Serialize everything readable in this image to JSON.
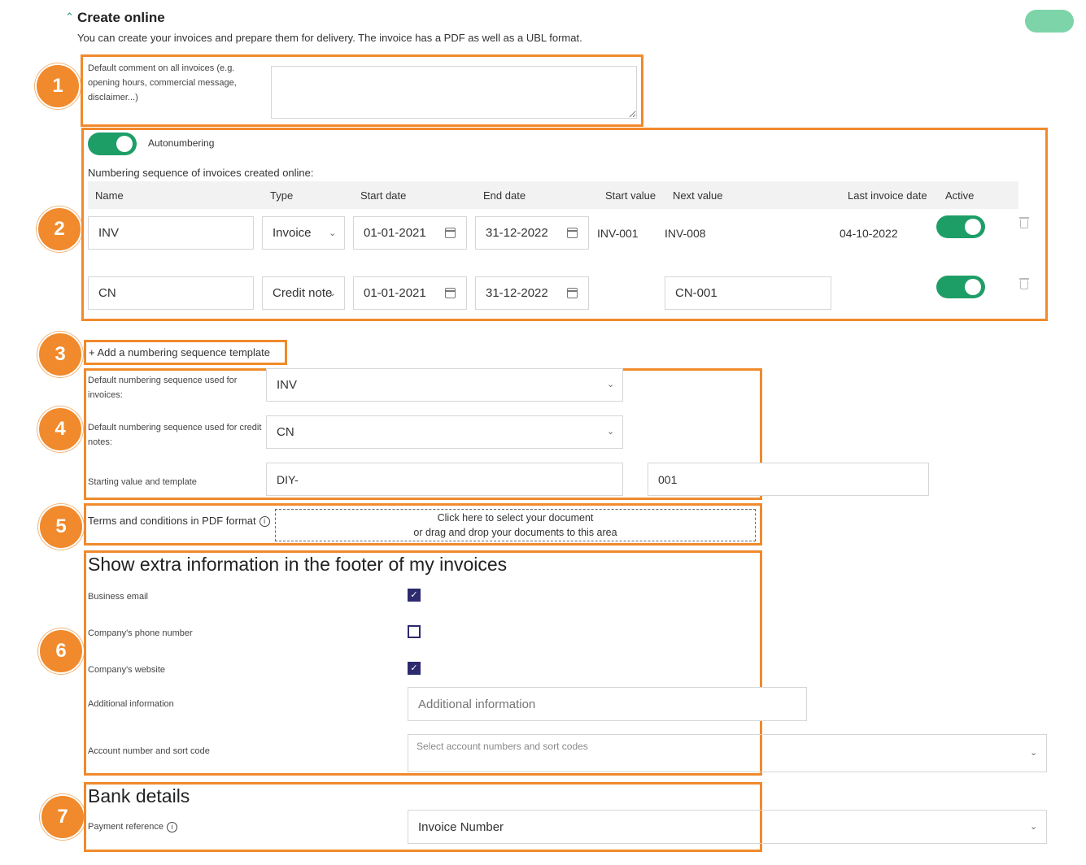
{
  "header": {
    "title": "Create online",
    "subtitle": "You can create your invoices and prepare them for delivery. The invoice has a PDF as well as a UBL format."
  },
  "badges": [
    "1",
    "2",
    "3",
    "4",
    "5",
    "6",
    "7"
  ],
  "section1": {
    "comment_label": "Default comment on all invoices (e.g. opening hours, commercial message, disclaimer...)",
    "comment_value": ""
  },
  "section2": {
    "autonumbering_label": "Autonumbering",
    "sequence_label": "Numbering sequence of invoices created online:",
    "columns": [
      "Name",
      "Type",
      "Start date",
      "End date",
      "Start value",
      "Next value",
      "Last invoice date",
      "Active"
    ],
    "rows": [
      {
        "name": "INV",
        "type": "Invoice",
        "start_date": "01-01-2021",
        "end_date": "31-12-2022",
        "start_value": "INV-001",
        "next_value": "INV-008",
        "last_invoice_date": "04-10-2022",
        "active": true
      },
      {
        "name": "CN",
        "type": "Credit note",
        "start_date": "01-01-2021",
        "end_date": "31-12-2022",
        "start_value": "",
        "next_value": "CN-001",
        "last_invoice_date": "",
        "active": true
      }
    ]
  },
  "section3": {
    "add_template_label": "+ Add a numbering sequence template"
  },
  "section4": {
    "invoices_label": "Default numbering sequence used for invoices:",
    "invoices_value": "INV",
    "credit_label": "Default numbering sequence used for credit notes:",
    "credit_value": "CN",
    "starting_label": "Starting value and template",
    "template_value": "DIY-",
    "start_value": "001"
  },
  "section5": {
    "terms_label": "Terms and conditions in PDF format",
    "drop_line1": "Click here to select your document",
    "drop_line2": "or drag and drop your documents to this area"
  },
  "section6": {
    "heading": "Show extra information in the footer of my invoices",
    "business_email_label": "Business email",
    "business_email_checked": true,
    "phone_label": "Company's phone number",
    "phone_checked": false,
    "website_label": "Company's website",
    "website_checked": true,
    "additional_label": "Additional information",
    "additional_placeholder": "Additional information",
    "account_label": "Account number and sort code",
    "account_placeholder": "Select account numbers and sort codes"
  },
  "section7": {
    "heading": "Bank details",
    "payment_ref_label": "Payment reference",
    "payment_ref_value": "Invoice Number"
  },
  "colors": {
    "accent": "#f08a2c",
    "toggle": "#1e9e67",
    "checkbox": "#2d2a6e",
    "top_button": "#7dd4a8"
  }
}
